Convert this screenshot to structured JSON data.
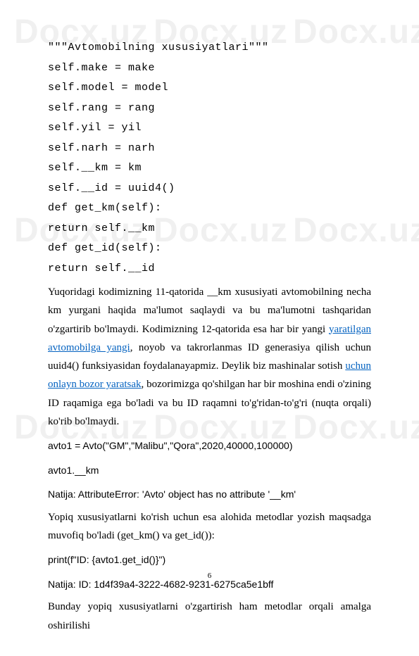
{
  "watermark": "Docx.uz",
  "code": {
    "l1": "\"\"\"Avtomobilning xususiyatlari\"\"\"",
    "l2": "self.make = make",
    "l3": "self.model = model",
    "l4": "self.rang = rang",
    "l5": "self.yil = yil",
    "l6": "self.narh = narh",
    "l7": "self.__km = km",
    "l8": "self.__id = uuid4()",
    "l9": "def get_km(self):",
    "l10": "return self.__km",
    "l11": "def get_id(self):",
    "l12": "return self.__id"
  },
  "para1": {
    "t1": "Yuqoridagi kodimizning 11-qatorida __km xususiyati avtomobilning necha km yurgani haqida ma'lumot saqlaydi va bu ma'lumotni tashqaridan o'zgartirib bo'lmaydi. Kodimizning 12-qatorida esa har bir yangi ",
    "link1": "yaratilgan avtomobilga yangi",
    "t2": ", noyob va takrorlanmas ID generasiya qilish uchun uuid4() funksiyasidan foydalanayapmiz. Deylik biz mashinalar sotish ",
    "link2": "uchun onlayn bozor yaratsak",
    "t3": ", bozorimizga qo'shilgan har bir moshina endi o'zining ID raqamiga ega bo'ladi va bu ID raqamni to'g'ridan-to'g'ri (nuqta orqali) ko'rib bo'lmaydi."
  },
  "sample": {
    "l1": "avto1 = Avto(\"GM\",\"Malibu\",\"Qora\",2020,40000,100000)",
    "l2": "avto1.__km",
    "l3": "Natija: AttributeError: 'Avto' object has no attribute '__km'"
  },
  "para2": "Yopiq xususiyatlarni ko'rish uchun esa alohida metodlar yozish maqsadga muvofiq bo'ladi (get_km() va get_id()):",
  "sample2": {
    "l1": "print(f\"ID: {avto1.get_id()}\")",
    "l2": "Natija: ID: 1d4f39a4-3222-4682-9231-6275ca5e1bff"
  },
  "para3": "Bunday yopiq xususiyatlarni o'zgartirish ham metodlar orqali amalga oshirilishi",
  "page": "6"
}
